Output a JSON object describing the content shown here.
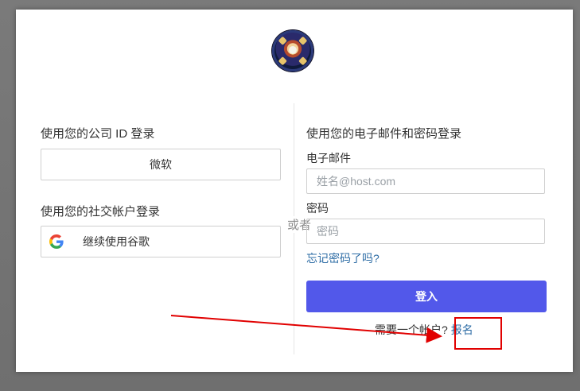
{
  "left": {
    "company_title": "使用您的公司 ID 登录",
    "microsoft_button": "微软",
    "social_title": "使用您的社交帐户登录",
    "google_button": "继续使用谷歌"
  },
  "divider_text": "或者",
  "right": {
    "title": "使用您的电子邮件和密码登录",
    "email_label": "电子邮件",
    "email_placeholder": "姓名@host.com",
    "password_label": "密码",
    "password_placeholder": "密码",
    "forgot_link": "忘记密码了吗?",
    "login_button": "登入",
    "signup_prompt": "需要一个帐户?",
    "signup_link": "报名"
  },
  "colors": {
    "primary": "#5258ea",
    "link": "#2d6ca5",
    "annotation": "#e10000"
  }
}
